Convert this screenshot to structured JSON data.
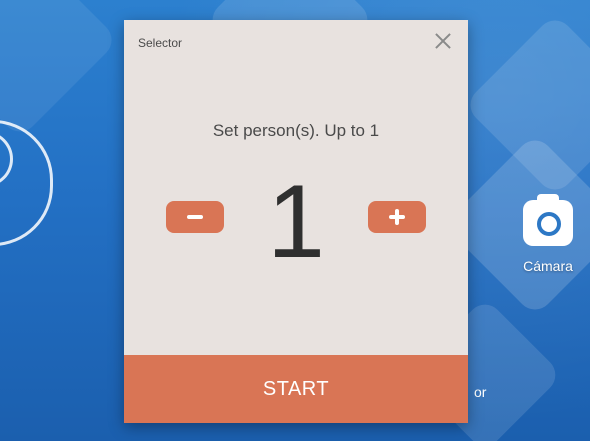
{
  "dialog": {
    "title": "Selector",
    "prompt": "Set person(s). Up to 1",
    "count": "1",
    "start_label": "START",
    "accent_color": "#d97555",
    "background_color": "#e8e2df",
    "icons": {
      "close": "close-icon",
      "decrement": "minus-icon",
      "increment": "plus-icon"
    }
  },
  "home_screen": {
    "apps": [
      {
        "label": "Cámara",
        "icon": "camera-icon"
      }
    ],
    "partial_label": "or"
  }
}
